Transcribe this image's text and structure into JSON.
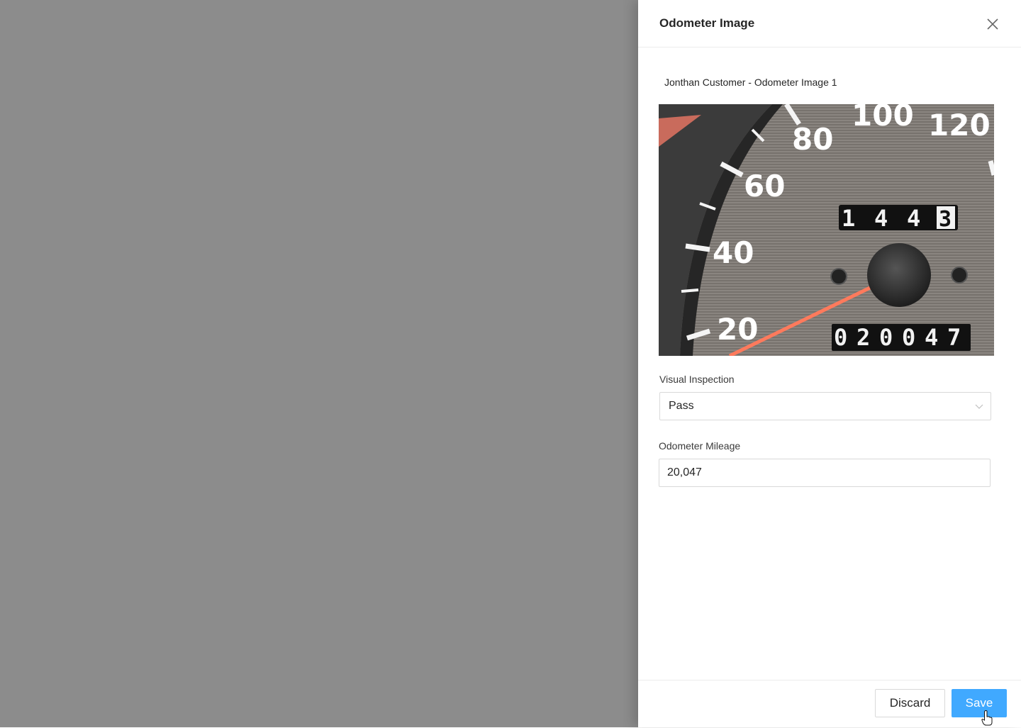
{
  "drawer": {
    "title": "Odometer Image",
    "image_caption": "Jonthan Customer - Odometer Image 1",
    "image": {
      "speed_labels": [
        "20",
        "40",
        "60",
        "80",
        "100",
        "120"
      ],
      "trip_counter": [
        "1",
        "4",
        "4",
        "3"
      ],
      "odometer_digits": [
        "0",
        "2",
        "0",
        "0",
        "4",
        "7"
      ]
    },
    "visual_inspection": {
      "label": "Visual Inspection",
      "selected": "Pass"
    },
    "odometer_mileage": {
      "label": "Odometer Mileage",
      "value": "20,047"
    },
    "footer": {
      "discard_label": "Discard",
      "save_label": "Save"
    }
  },
  "colors": {
    "overlay": "#8c8c8c",
    "primary": "#40a9ff",
    "needle": "#ff7a5c"
  },
  "icons": {
    "close": "close-icon",
    "dropdown": "chevron-down-icon",
    "cursor": "hand-pointer-icon"
  }
}
